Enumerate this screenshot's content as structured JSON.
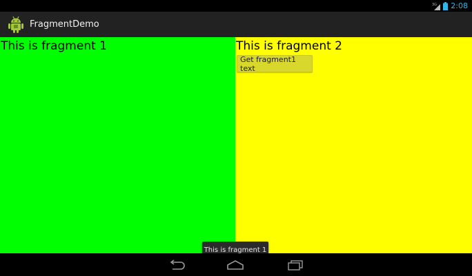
{
  "status_bar": {
    "network_label": "3G",
    "time": "2:08",
    "signal_icon": "signal-icon",
    "battery_icon": "battery-icon"
  },
  "action_bar": {
    "app_icon": "android-robot-icon",
    "title": "FragmentDemo"
  },
  "fragment_1": {
    "text": "This is fragment 1",
    "background": "#00ff00"
  },
  "fragment_2": {
    "text": "This is fragment 2",
    "button_label": "Get fragment1 text",
    "background": "#ffff00"
  },
  "toast": {
    "text": "This is fragment 1"
  },
  "nav_bar": {
    "back_icon": "back-icon",
    "home_icon": "home-icon",
    "recents_icon": "recents-icon"
  },
  "colors": {
    "status_clock": "#33b5e5",
    "action_bar_bg": "#222222",
    "button_bg": "#d8d82c"
  }
}
